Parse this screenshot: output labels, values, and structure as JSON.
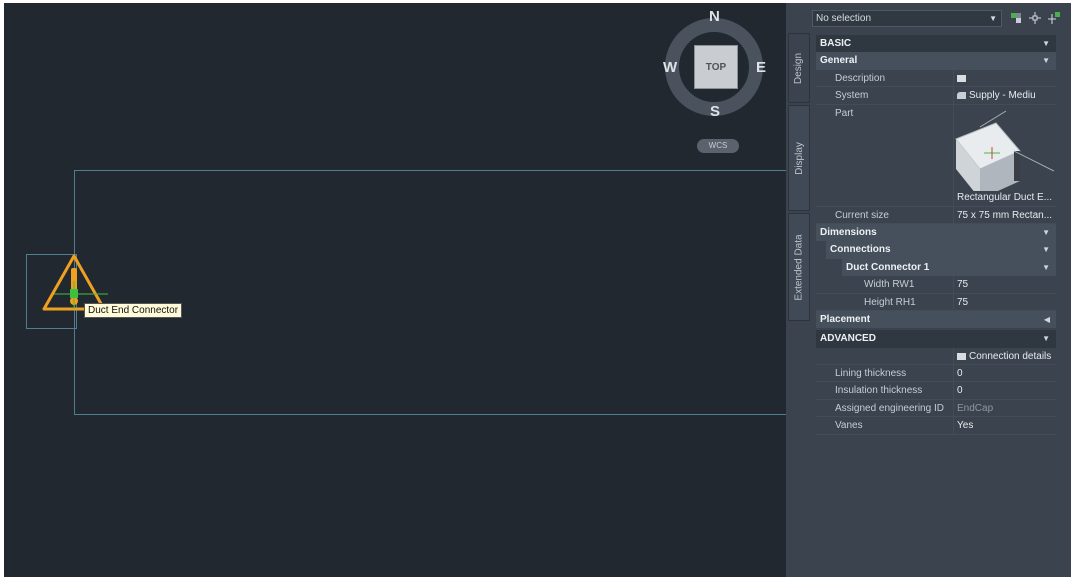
{
  "viewcube": {
    "north": "N",
    "south": "S",
    "east": "E",
    "west": "W",
    "face": "TOP",
    "ucs": "WCS"
  },
  "tooltip": "Duct End Connector",
  "palette": {
    "tabs": [
      "Design",
      "Display",
      "Extended Data"
    ],
    "selection": "No selection",
    "basic": "BASIC",
    "general": "General",
    "description_label": "Description",
    "system_label": "System",
    "system_value": "Supply - Mediu",
    "part_label": "Part",
    "part_value": "Rectangular Duct E...",
    "current_size_label": "Current size",
    "current_size_value": "75 x 75 mm Rectan...",
    "dimensions": "Dimensions",
    "connections": "Connections",
    "duct_connector": "Duct Connector 1",
    "width_label": "Width RW1",
    "width_value": "75",
    "height_label": "Height RH1",
    "height_value": "75",
    "placement": "Placement",
    "advanced": "ADVANCED",
    "connection_details": "Connection details",
    "lining_label": "Lining thickness",
    "lining_value": "0",
    "insulation_label": "Insulation thickness",
    "insulation_value": "0",
    "engid_label": "Assigned engineering ID",
    "engid_value": "EndCap",
    "vanes_label": "Vanes",
    "vanes_value": "Yes"
  },
  "colors": {
    "canvas": "#212830",
    "palette": "#3a434e",
    "warning": "#f0a020",
    "cursor": "#3fbf3f"
  }
}
